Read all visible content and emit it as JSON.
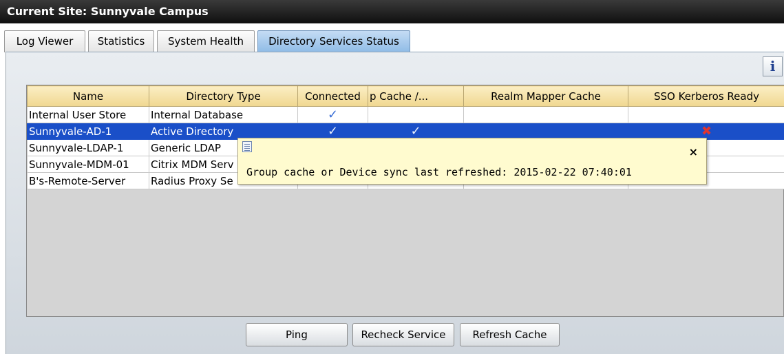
{
  "window": {
    "title": "Current Site:  Sunnyvale Campus"
  },
  "tabs": [
    {
      "label": "Log Viewer",
      "active": false
    },
    {
      "label": "Statistics",
      "active": false
    },
    {
      "label": "System Health",
      "active": false
    },
    {
      "label": "Directory Services Status",
      "active": true
    }
  ],
  "info_button": {
    "label": "i"
  },
  "table": {
    "columns": [
      "Name",
      "Directory Type",
      "Connected",
      "p Cache /...",
      "Realm Mapper Cache",
      "SSO Kerberos Ready"
    ],
    "rows": [
      {
        "name": "Internal User Store",
        "type": "Internal Database",
        "connected": "✓",
        "cache": "",
        "realm": "",
        "sso": "",
        "selected": false
      },
      {
        "name": "Sunnyvale-AD-1",
        "type": "Active Directory",
        "connected": "✓",
        "cache": "✓",
        "realm": "",
        "sso": "✖",
        "selected": true
      },
      {
        "name": "Sunnyvale-LDAP-1",
        "type": "Generic LDAP",
        "connected": "",
        "cache": "",
        "realm": "",
        "sso": "",
        "selected": false
      },
      {
        "name": "Sunnyvale-MDM-01",
        "type": "Citrix MDM Serv",
        "connected": "",
        "cache": "",
        "realm": "",
        "sso": "",
        "selected": false
      },
      {
        "name": "B's-Remote-Server",
        "type": "Radius Proxy Se",
        "connected": "",
        "cache": "",
        "realm": "",
        "sso": "",
        "selected": false
      }
    ]
  },
  "tooltip": {
    "text": "Group cache or Device sync last refreshed: 2015-02-22 07:40:01",
    "close": "×",
    "icon": "document-icon"
  },
  "buttons": {
    "ping": "Ping",
    "recheck": "Recheck Service",
    "refresh": "Refresh Cache"
  },
  "colors": {
    "selection": "#1a4fc8",
    "header": "#f0d790",
    "active_tab": "#8fbbe6",
    "tooltip_bg": "#fffbcf",
    "error": "#e0352f"
  }
}
